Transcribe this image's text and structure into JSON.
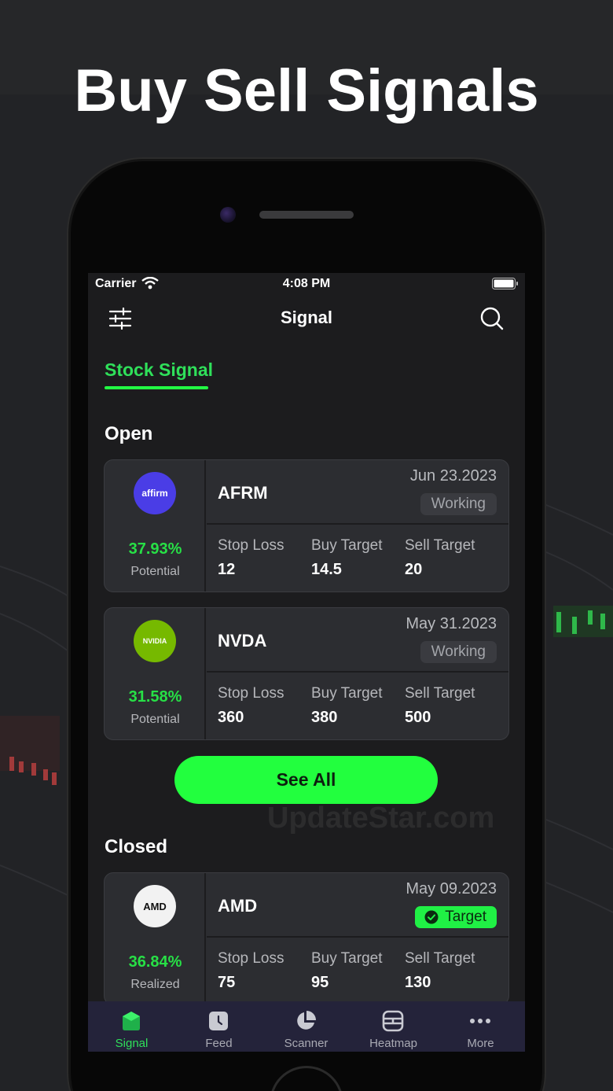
{
  "headline": "Buy Sell Signals",
  "status_bar": {
    "carrier": "Carrier",
    "time": "4:08 PM"
  },
  "nav": {
    "title": "Signal"
  },
  "tab": {
    "label": "Stock Signal"
  },
  "sections": {
    "open": "Open",
    "closed": "Closed"
  },
  "metric_labels": {
    "stop_loss": "Stop Loss",
    "buy_target": "Buy Target",
    "sell_target": "Sell Target"
  },
  "open_signals": [
    {
      "ticker": "AFRM",
      "logo_text": "affirm",
      "date": "Jun 23.2023",
      "status": "Working",
      "percent": "37.93%",
      "percent_label": "Potential",
      "stop_loss": "12",
      "buy_target": "14.5",
      "sell_target": "20"
    },
    {
      "ticker": "NVDA",
      "logo_text": "NVIDIA",
      "date": "May 31.2023",
      "status": "Working",
      "percent": "31.58%",
      "percent_label": "Potential",
      "stop_loss": "360",
      "buy_target": "380",
      "sell_target": "500"
    }
  ],
  "see_all_label": "See All",
  "closed_signals": [
    {
      "ticker": "AMD",
      "logo_text": "AMD",
      "date": "May 09.2023",
      "status": "Target",
      "percent": "36.84%",
      "percent_label": "Realized",
      "stop_loss": "75",
      "buy_target": "95",
      "sell_target": "130"
    }
  ],
  "watermark": "UpdateStar.com",
  "tab_bar": [
    {
      "label": "Signal",
      "icon": "signal-icon"
    },
    {
      "label": "Feed",
      "icon": "feed-icon"
    },
    {
      "label": "Scanner",
      "icon": "scanner-icon"
    },
    {
      "label": "Heatmap",
      "icon": "heatmap-icon"
    },
    {
      "label": "More",
      "icon": "more-icon"
    }
  ],
  "colors": {
    "accent": "#22ff3e",
    "positive": "#27e046",
    "card": "#2c2d31",
    "screen": "#1c1c1e"
  }
}
